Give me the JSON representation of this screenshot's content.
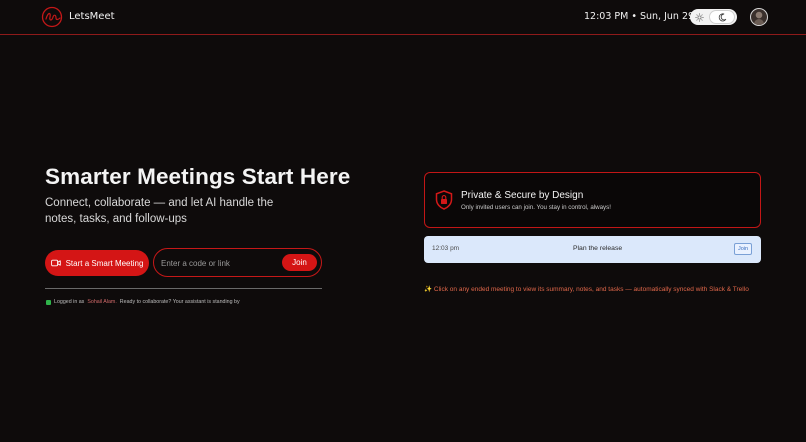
{
  "header": {
    "brand": "LetsMeet",
    "clock": "12:03 PM • Sun, Jun 29",
    "theme_toggle": {
      "light_icon": "sun-icon",
      "dark_icon": "moon-icon",
      "active": "dark"
    },
    "avatar_icon": "user-avatar"
  },
  "hero": {
    "title": "Smarter Meetings Start Here",
    "subtitle": "Connect, collaborate — and let AI handle the notes, tasks, and follow-ups",
    "start_button": "Start a Smart Meeting",
    "start_icon": "video-camera-icon",
    "join_placeholder": "Enter a code or link",
    "join_value": "",
    "join_button": "Join",
    "status_prefix": "Logged in as",
    "status_user": "Sohail Alam.",
    "status_suffix": "Ready to collaborate? Your assistant is standing by"
  },
  "secure_card": {
    "icon": "shield-lock-icon",
    "title": "Private & Secure by Design",
    "description": "Only invited users can join. You stay in control, always!"
  },
  "meeting_card": {
    "time": "12:03 pm",
    "name": "Plan the release",
    "join_label": "Join"
  },
  "hint": "✨ Click on any ended meeting to view its summary, notes, and tasks — automatically synced with Slack & Trello",
  "colors": {
    "background": "#0e0b0b",
    "accent": "#d41515",
    "meeting_card_bg": "#dbe8fb",
    "hint": "#e0674a"
  }
}
